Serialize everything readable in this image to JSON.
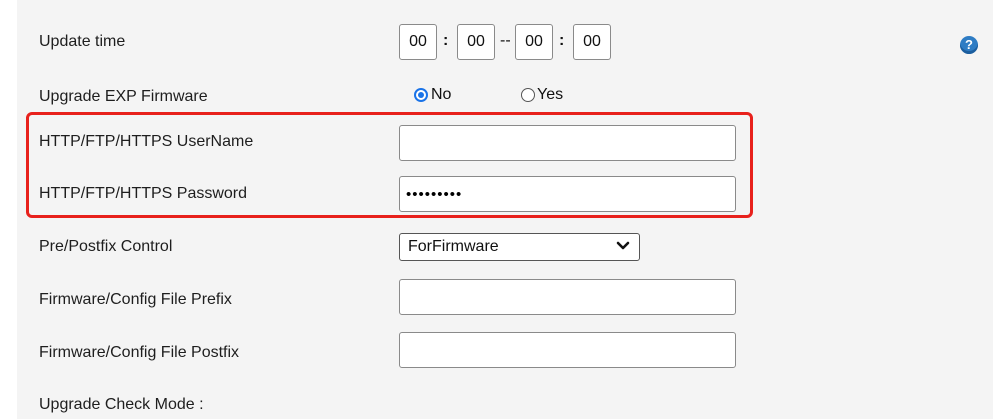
{
  "update_time": {
    "label": "Update time",
    "start_hour": "00",
    "start_minute": "00",
    "end_hour": "00",
    "end_minute": "00",
    "colon": ":",
    "dash": "--"
  },
  "upgrade_exp_firmware": {
    "label": "Upgrade EXP Firmware",
    "options": [
      "No",
      "Yes"
    ],
    "selected": "No"
  },
  "http_username": {
    "label": "HTTP/FTP/HTTPS UserName",
    "value": ""
  },
  "http_password": {
    "label": "HTTP/FTP/HTTPS Password",
    "value": "•••••••••"
  },
  "prepostfix_control": {
    "label": "Pre/Postfix Control",
    "selected": "ForFirmware"
  },
  "file_prefix": {
    "label": "Firmware/Config File Prefix",
    "value": ""
  },
  "file_postfix": {
    "label": "Firmware/Config File Postfix",
    "value": ""
  },
  "upgrade_check_mode": {
    "label": "Upgrade Check Mode :"
  },
  "help_icon": "help-question-icon",
  "colors": {
    "highlight": "#e8211c",
    "radio_accent": "#1a73e8",
    "panel_bg": "#f4f4f4"
  }
}
